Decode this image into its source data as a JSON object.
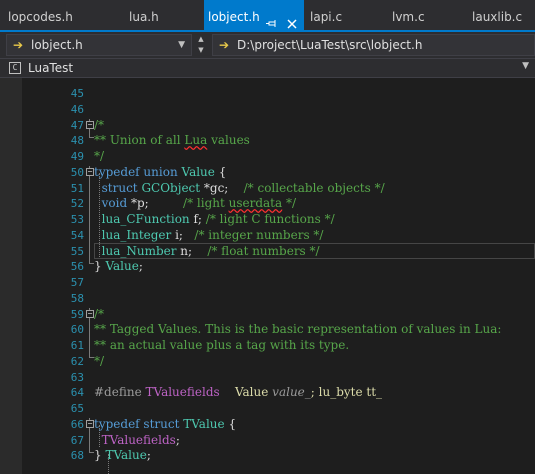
{
  "tabs": [
    {
      "label": "lopcodes.h",
      "active": false
    },
    {
      "label": "lua.h",
      "active": false
    },
    {
      "label": "lobject.h",
      "active": true
    },
    {
      "label": "lapi.c",
      "active": false
    },
    {
      "label": "lvm.c",
      "active": false
    },
    {
      "label": "lauxlib.c",
      "active": false
    }
  ],
  "tab_icons": {
    "pin": "pin-icon",
    "close": "close-icon"
  },
  "navigation": {
    "file_dropdown": "lobject.h",
    "path": "D:\\project\\LuaTest\\src\\lobject.h"
  },
  "project": {
    "name": "LuaTest",
    "icon": "project-icon"
  },
  "editor": {
    "line_numbers": [
      "45",
      "46",
      "47",
      "48",
      "49",
      "50",
      "51",
      "52",
      "53",
      "54",
      "55",
      "56",
      "57",
      "58",
      "59",
      "60",
      "61",
      "62",
      "63",
      "64",
      "65",
      "66",
      "67",
      "68"
    ],
    "lines": {
      "l46": "/*",
      "l47a": "** Union of all ",
      "l47b": "Lua",
      "l47c": " values",
      "l48": "*/",
      "l49a": "typedef",
      "l49b": " union ",
      "l49c": "Value",
      "l49d": " {",
      "l50a": "  struct ",
      "l50b": "GCObject",
      "l50c": " *gc;    ",
      "l50d": "/* collectable objects */",
      "l51a": "  void",
      "l51b": " *p;         ",
      "l51c": "/* light ",
      "l51d": "userdata",
      "l51e": " */",
      "l52a": "  lua_CFunction",
      "l52b": " f; ",
      "l52c": "/* light C functions */",
      "l53a": "  lua_Integer",
      "l53b": " i;   ",
      "l53c": "/* integer numbers */",
      "l54a": "  lua_Number",
      "l54b": " n;    ",
      "l54c": "/* float numbers */",
      "l55a": "} ",
      "l55b": "Value",
      "l55c": ";",
      "l58": "/*",
      "l59": "** Tagged Values. This is the basic representation of values in Lua:",
      "l60": "** an actual value plus a tag with its type.",
      "l61": "*/",
      "l63a": "#define ",
      "l63b": "TValuefields",
      "l63c": "    ",
      "l63d": "Value",
      "l63e": " ",
      "l63f": "value_",
      "l63g": "; lu_byte tt_",
      "l65a": "typedef",
      "l65b": " struct ",
      "l65c": "TValue",
      "l65d": " {",
      "l66a": "  ",
      "l66b": "TValuefields",
      "l66c": ";",
      "l67a": "} ",
      "l67b": "TValue",
      "l67c": ";"
    },
    "fold_glyph": "−"
  }
}
